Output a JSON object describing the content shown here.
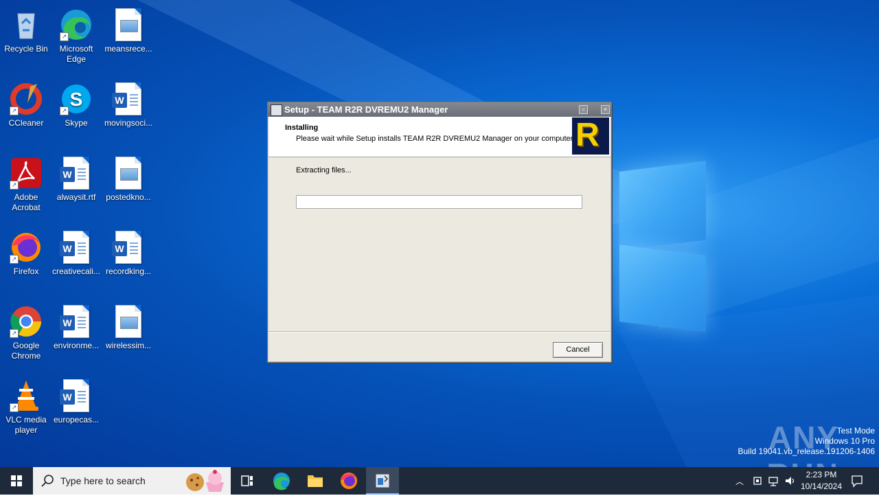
{
  "desktop": {
    "icons": [
      {
        "label": "Recycle Bin",
        "icon": "recycle-bin-icon"
      },
      {
        "label": "Microsoft Edge",
        "icon": "edge-icon"
      },
      {
        "label": "meansrece...",
        "icon": "image-file-icon"
      },
      {
        "label": "CCleaner",
        "icon": "ccleaner-icon"
      },
      {
        "label": "Skype",
        "icon": "skype-icon"
      },
      {
        "label": "movingsoci...",
        "icon": "word-doc-icon"
      },
      {
        "label": "Adobe Acrobat",
        "icon": "acrobat-icon"
      },
      {
        "label": "alwaysit.rtf",
        "icon": "word-doc-icon"
      },
      {
        "label": "postedkno...",
        "icon": "image-file-icon"
      },
      {
        "label": "Firefox",
        "icon": "firefox-icon"
      },
      {
        "label": "creativecali...",
        "icon": "word-doc-icon"
      },
      {
        "label": "recordking...",
        "icon": "word-doc-icon"
      },
      {
        "label": "Google Chrome",
        "icon": "chrome-icon"
      },
      {
        "label": "environme...",
        "icon": "word-doc-icon"
      },
      {
        "label": "wirelessim...",
        "icon": "image-file-icon"
      },
      {
        "label": "VLC media player",
        "icon": "vlc-icon"
      },
      {
        "label": "europecas...",
        "icon": "word-doc-icon"
      }
    ]
  },
  "dialog": {
    "title": "Setup - TEAM R2R DVREMU2 Manager",
    "heading": "Installing",
    "subheading": "Please wait while Setup installs TEAM R2R DVREMU2 Manager on your computer.",
    "status": "Extracting files...",
    "progress": 0,
    "cancel_label": "Cancel",
    "logo_letter": "R"
  },
  "watermark": {
    "brand": "ANY RUN",
    "line1": "Test Mode",
    "line2": "Windows 10 Pro",
    "line3": "Build 19041.vb_release.191206-1406"
  },
  "taskbar": {
    "search_placeholder": "Type here to search",
    "time": "2:23 PM",
    "date": "10/14/2024",
    "accent": "#0a6fd8"
  }
}
